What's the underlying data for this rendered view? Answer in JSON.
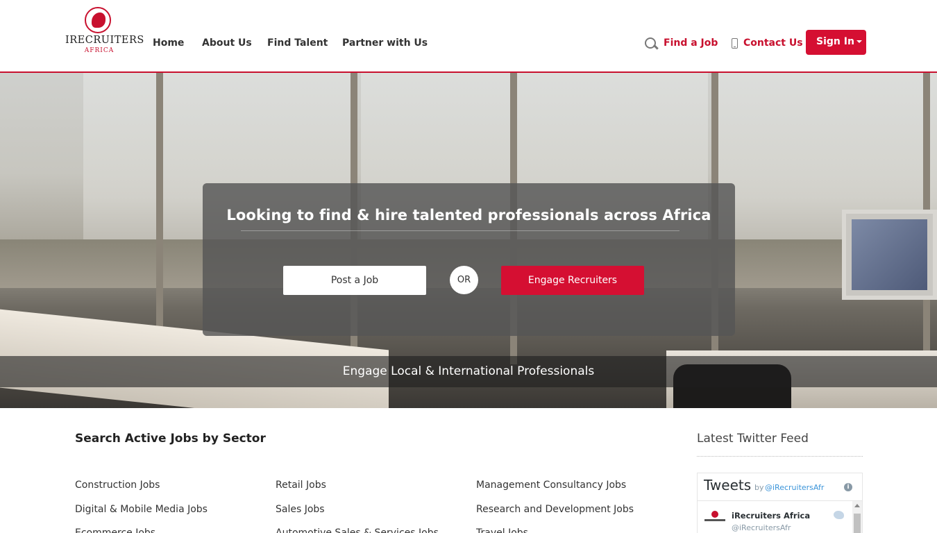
{
  "header": {
    "logo": {
      "name": "IRECRUITERS",
      "sub": "AFRICA"
    },
    "nav": [
      "Home",
      "About Us",
      "Find Talent",
      "Partner with Us"
    ],
    "find_job": "Find a Job",
    "contact": "Contact Us",
    "sign_in": "Sign In"
  },
  "hero": {
    "title": "Looking to find & hire talented professionals across Africa",
    "post_job": "Post a Job",
    "or": "OR",
    "engage": "Engage Recruiters",
    "tagline": "Engage Local & International Professionals"
  },
  "sectors": {
    "title": "Search Active Jobs by Sector",
    "col1": [
      "Construction Jobs",
      "Digital & Mobile Media Jobs",
      "Ecommerce Jobs"
    ],
    "col2": [
      "Retail Jobs",
      "Sales Jobs",
      "Automotive Sales & Services Jobs"
    ],
    "col3": [
      "Management Consultancy Jobs",
      "Research and Development Jobs",
      "Travel Jobs"
    ]
  },
  "twitter": {
    "heading": "Latest Twitter Feed",
    "tweets_label": "Tweets",
    "by": "by",
    "handle_top": "@iRecruitersAfr",
    "tweet_name": "iRecruiters Africa",
    "tweet_handle": "@iRecruitersAfr",
    "info_icon": "i"
  },
  "colors": {
    "brand_red": "#d50f32",
    "text_dark": "#333333"
  },
  "icons": [
    "search-icon",
    "mobile-phone-icon",
    "caret-down-icon",
    "info-icon",
    "twitter-bird-icon"
  ]
}
